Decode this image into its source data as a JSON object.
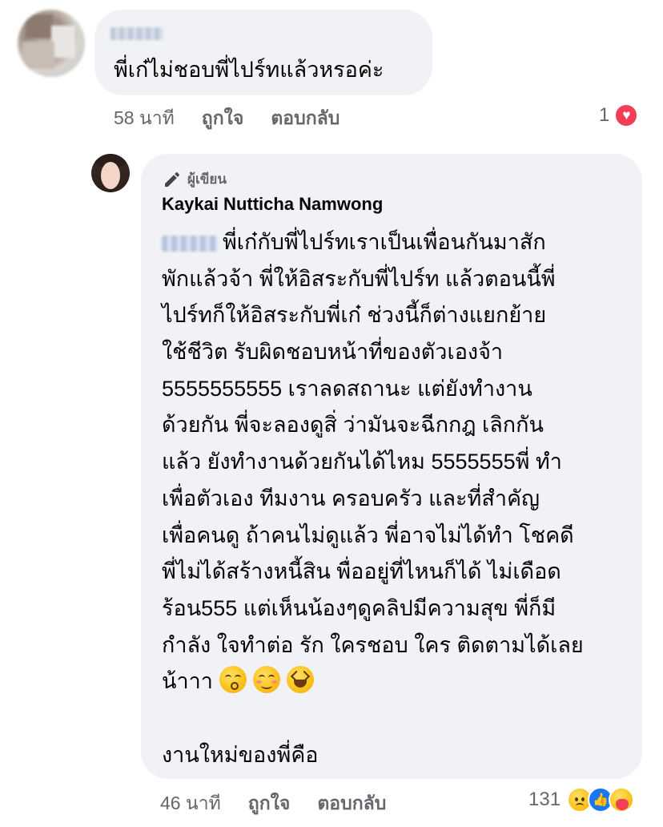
{
  "comment": {
    "text": "พี่เก๋ไม่ชอบพี่ไปร์ทแล้วหรอค่ะ",
    "time": "58 นาที",
    "like_label": "ถูกใจ",
    "reply_label": "ตอบกลับ",
    "reaction_count": "1",
    "reaction_icons": [
      "heart-icon"
    ]
  },
  "reply": {
    "author_badge": "ผู้เขียน",
    "author_name": "Kaykai Nutticha Namwong",
    "lines": [
      "พี่เก๋กับพี่ไปร์ทเราเป็นเพื่อนกันมาสัก",
      "พักแล้วจ้า พี่ให้อิสระกับพี่ไปร์ท แล้วตอนนี้พี่",
      "ไปร์ทก็ให้อิสระกับพี่เก๋ ช่วงนี้ก็ต่างแยกย้าย",
      "ใช้ชีวิต รับผิดชอบหน้าที่ของตัวเองจ้า",
      "5555555555 เราลดสถานะ แต่ยังทำงาน",
      "ด้วยกัน พี่จะลองดูสิ่ ว่ามันจะฉีกกฎ เลิกกัน",
      "แล้ว ยังทำงานด้วยกันได้ไหม 5555555พี่ ทำ",
      "เพื่อตัวเอง ทีมงาน ครอบครัว และที่สำคัญ",
      "เพื่อคนดู ถ้าคนไม่ดูแล้ว พี่อาจไม่ได้ทำ โชคดี",
      "พี่ไม่ได้สร้างหนี้สิน พื่ออยู่ที่ไหนก็ได้ ไม่เดือด",
      "ร้อน555 แต่เห็นน้องๆดูคลิปมีความสุข พี่ก็มี",
      "กำลัง ใจทำต่อ รัก ใครชอบ ใคร ติดตามได้เลย",
      "น้าาา",
      "",
      "งานใหม่ของพี่คือ"
    ],
    "emojis": [
      "kissing-face-icon",
      "smiling-face-icon",
      "grinning-squinting-face-icon"
    ],
    "time": "46 นาที",
    "like_label": "ถูกใจ",
    "reply_label": "ตอบกลับ",
    "reaction_count": "131",
    "reaction_icons": [
      "sad-icon",
      "like-icon",
      "care-icon"
    ]
  },
  "colors": {
    "bubble": "#f0f2f5",
    "secondary_text": "#65676b",
    "heart": "#f33e58",
    "like_blue": "#1877f2"
  }
}
